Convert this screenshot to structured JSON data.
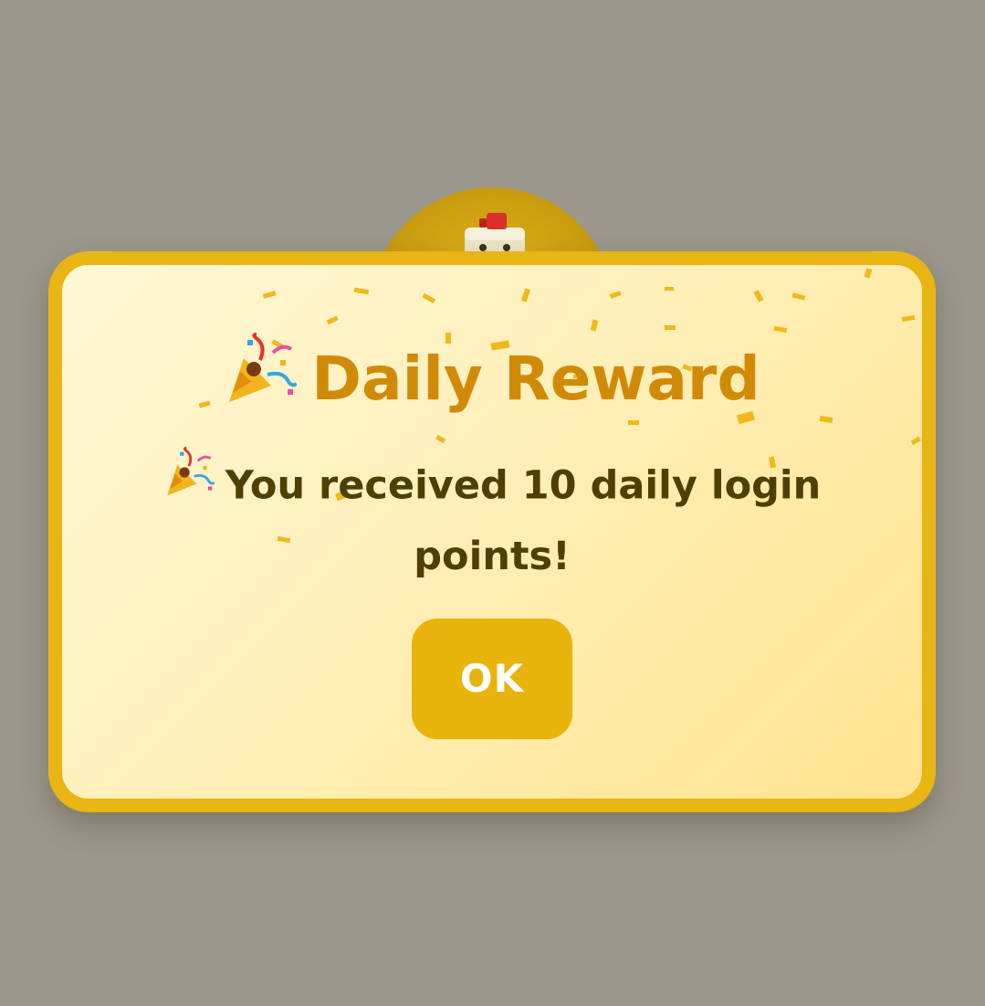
{
  "dialog": {
    "title": "Daily Reward",
    "title_icon": "party-popper-icon",
    "message": "You received 10 daily login points!",
    "message_icon": "party-popper-icon",
    "ok_label": "OK"
  },
  "colors": {
    "backdrop": "#9a978c",
    "border": "#e8b514",
    "title": "#d18a08",
    "message": "#4e3f02",
    "button": "#e8b30a",
    "button_text": "#ffffff"
  }
}
